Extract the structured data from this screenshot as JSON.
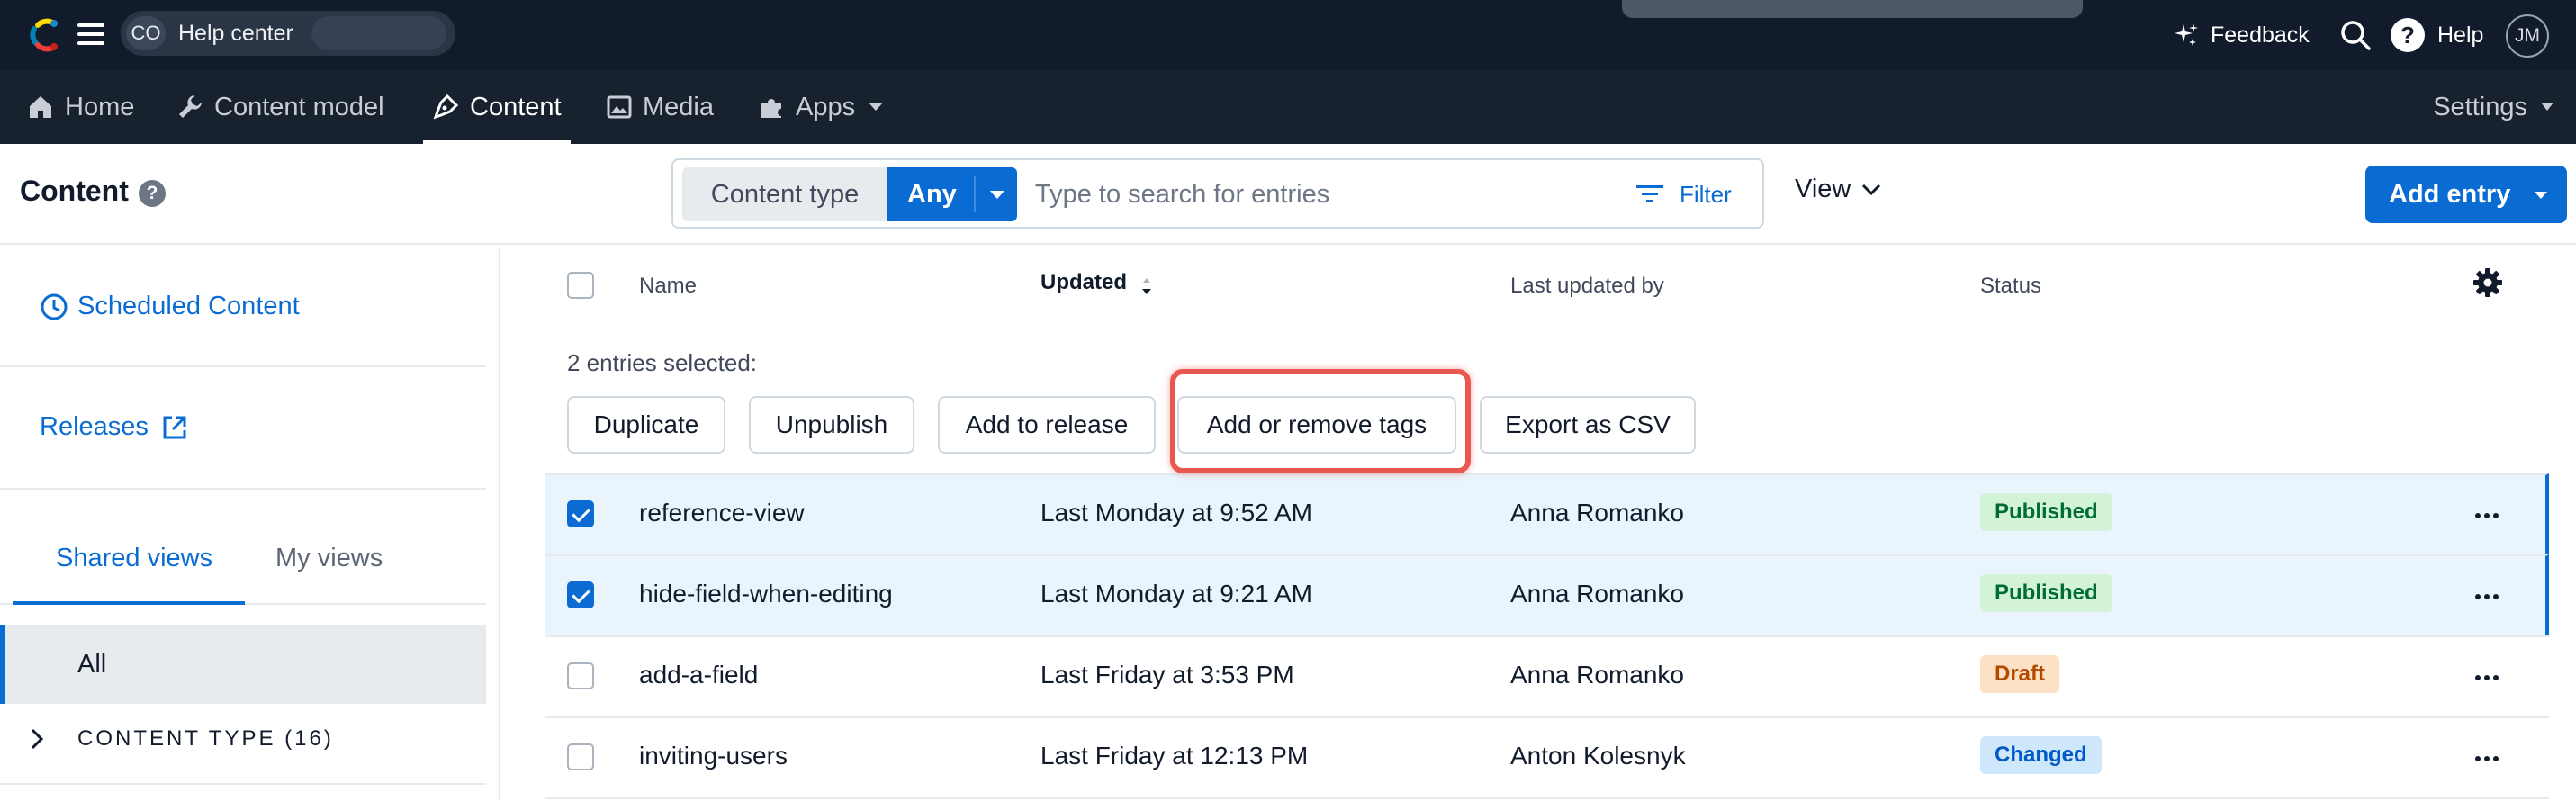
{
  "topbar": {
    "space_initials": "CO",
    "space_name": "Help center",
    "feedback_label": "Feedback",
    "help_label": "Help",
    "user_initials": "JM"
  },
  "nav": {
    "home": "Home",
    "content_model": "Content model",
    "content": "Content",
    "media": "Media",
    "apps": "Apps",
    "settings": "Settings"
  },
  "header": {
    "title": "Content",
    "content_type_label": "Content type",
    "content_type_value": "Any",
    "search_placeholder": "Type to search for entries",
    "filter_label": "Filter",
    "view_label": "View",
    "add_entry_label": "Add entry"
  },
  "sidebar": {
    "scheduled": "Scheduled Content",
    "releases": "Releases",
    "tab_shared": "Shared views",
    "tab_mine": "My views",
    "view_all": "All",
    "content_type_group": "CONTENT TYPE (16)"
  },
  "table": {
    "columns": {
      "name": "Name",
      "updated": "Updated",
      "updated_by": "Last updated by",
      "status": "Status"
    },
    "selected_text": "2 entries selected:",
    "bulk_actions": {
      "duplicate": "Duplicate",
      "unpublish": "Unpublish",
      "add_to_release": "Add to release",
      "tags": "Add or remove tags",
      "export": "Export as CSV"
    },
    "rows": [
      {
        "name": "reference-view",
        "updated": "Last Monday at 9:52 AM",
        "by": "Anna Romanko",
        "status": "Published",
        "selected": true
      },
      {
        "name": "hide-field-when-editing",
        "updated": "Last Monday at 9:21 AM",
        "by": "Anna Romanko",
        "status": "Published",
        "selected": true
      },
      {
        "name": "add-a-field",
        "updated": "Last Friday at 3:53 PM",
        "by": "Anna Romanko",
        "status": "Draft",
        "selected": false
      },
      {
        "name": "inviting-users",
        "updated": "Last Friday at 12:13 PM",
        "by": "Anton Kolesnyk",
        "status": "Changed",
        "selected": false
      }
    ]
  },
  "colors": {
    "topbar_bg": "#111b2b",
    "navbar_bg": "#18222f",
    "primary_blue": "#0a6cd3",
    "highlight_red": "#e8584f",
    "published_bg": "#d3f3d9",
    "draft_bg": "#fde1c4",
    "changed_bg": "#cfe7fb"
  }
}
